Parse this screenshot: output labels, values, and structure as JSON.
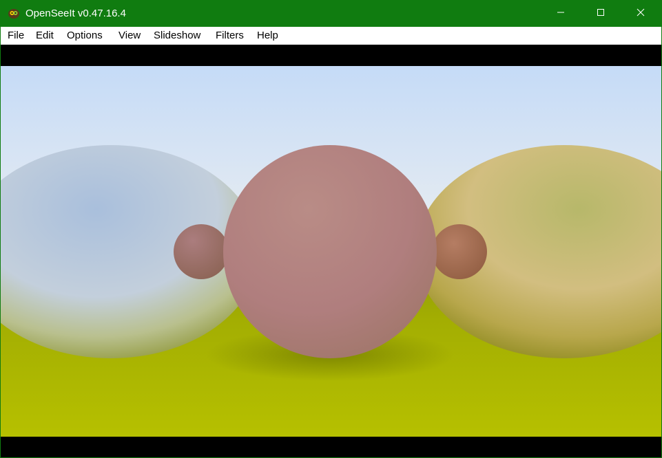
{
  "window": {
    "title": "OpenSeeIt v0.47.16.4",
    "app_icon": "openseeit-app-icon",
    "controls": {
      "minimize_icon": "minimize-icon",
      "maximize_icon": "maximize-icon",
      "close_icon": "close-icon"
    },
    "colors": {
      "titlebar": "#107c10",
      "menubar": "#ffffff",
      "viewer_background": "#000000"
    }
  },
  "menu": {
    "items": [
      {
        "label": "File"
      },
      {
        "label": "Edit"
      },
      {
        "label": "Options"
      },
      {
        "label": "View"
      },
      {
        "label": "Slideshow"
      },
      {
        "label": "Filters"
      },
      {
        "label": "Help"
      }
    ]
  },
  "image": {
    "content": "rendered-image-three-spheres-on-green-ground",
    "colors": {
      "sky_top": "#c5dbf7",
      "sky_horizon": "#e8f0f6",
      "ground": "#a2ad00",
      "center_sphere": "#b07e7e",
      "left_sphere": "#b9c6d8",
      "right_sphere": "#c9b871"
    }
  }
}
